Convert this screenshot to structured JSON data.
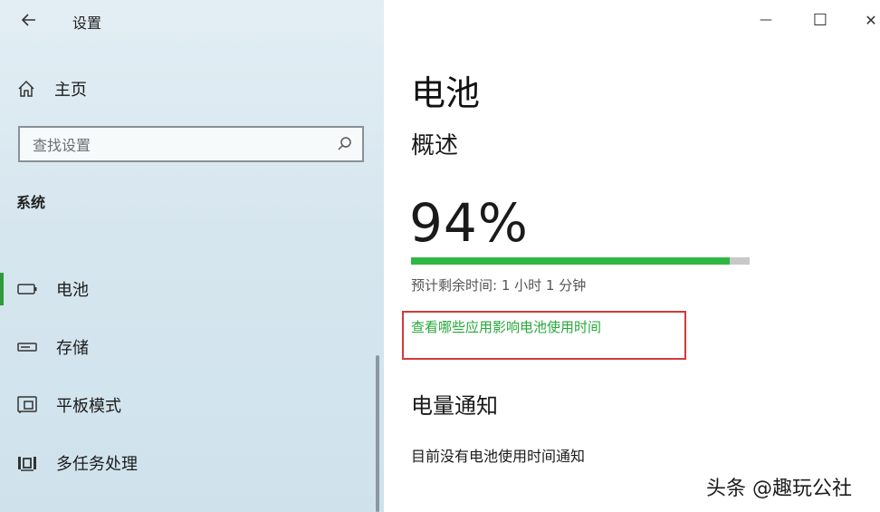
{
  "window": {
    "title": "设置",
    "controls": {
      "minimize": "—",
      "maximize": "☐",
      "close": "✕"
    }
  },
  "sidebar": {
    "home_label": "主页",
    "search_placeholder": "查找设置",
    "section_label": "系统",
    "items": [
      {
        "label": "电池",
        "icon": "battery-icon",
        "selected": true
      },
      {
        "label": "存储",
        "icon": "storage-icon",
        "selected": false
      },
      {
        "label": "平板模式",
        "icon": "tablet-mode-icon",
        "selected": false
      },
      {
        "label": "多任务处理",
        "icon": "multitasking-icon",
        "selected": false
      }
    ]
  },
  "main": {
    "title": "电池",
    "overview_heading": "概述",
    "battery_percent_text": "94%",
    "battery_percent": 94,
    "estimate_text": "预计剩余时间: 1 小时 1 分钟",
    "usage_link": "查看哪些应用影响电池使用时间",
    "notify_heading": "电量通知",
    "notify_text": "目前没有电池使用时间通知"
  },
  "watermark": "头条 @趣玩公社",
  "colors": {
    "accent_green": "#2eb843",
    "link_green": "#27a83a",
    "highlight_red": "#d23a3a",
    "sidebar_bg": "#d6e6ef"
  }
}
